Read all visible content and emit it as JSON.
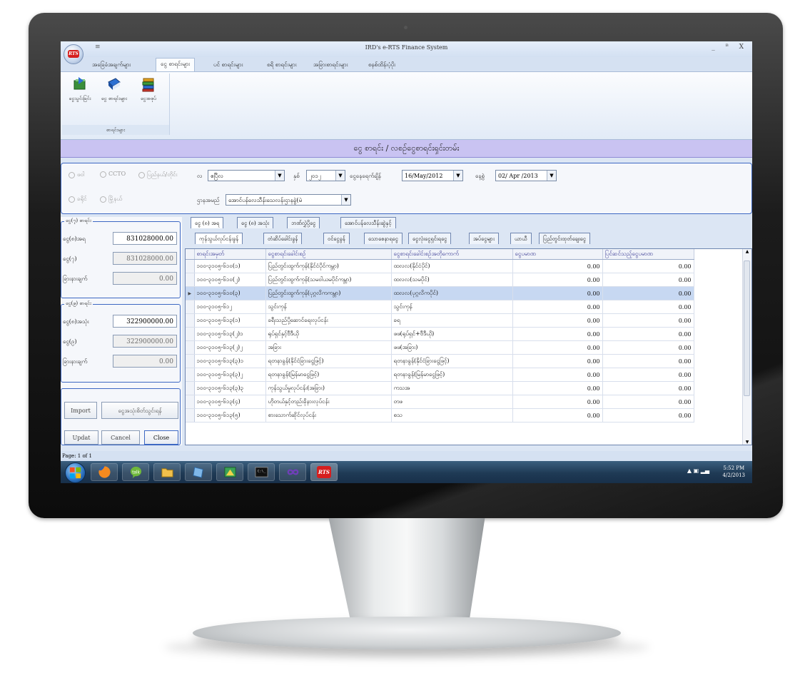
{
  "window": {
    "title": "IRD's e-RTS Finance System",
    "quick_access": "≡",
    "controls": "_ ᴮ X"
  },
  "menu_tabs": [
    {
      "label": "အခြေခံအချက်များ"
    },
    {
      "label": "ငွေ စာရင်းများ"
    },
    {
      "label": "ပင် စာရင်းများ"
    },
    {
      "label": "စရိ စာရင်းများ"
    },
    {
      "label": "အခြားစာရင်းများ"
    },
    {
      "label": "စနစ်ထိန်းပံ့ပိုး"
    }
  ],
  "ribbon": {
    "buttons": [
      {
        "label": "ငွေသွင်းခြင်း"
      },
      {
        "label": "ငွေ စာရင်းများ"
      },
      {
        "label": "ငွေအစုပ်"
      }
    ],
    "group_label": "စာရင်းများ"
  },
  "page_header": "ငွေ စာရင်း / လစဉ်ငွေစာရင်းရှင်းတမ်း",
  "filters": {
    "radios": [
      "ဖဝါ",
      "CCTO",
      "ပြည်နယ်/တိုင်း",
      "ခရိုင်",
      "မြို့နယ်"
    ],
    "month_label": "လ",
    "month_value": "ဧပြီလ",
    "year_label": "နှစ်",
    "year_value": "၂၀၁၂",
    "from_label": "ငွေနေရေက်ချိန်",
    "from_value": "16/May/2012",
    "to_label": "နေ့စွဲ",
    "to_value": "02/ Apr /2013",
    "office_label": "ဌာနအမည်",
    "office_value": "အောင်ပန်လေသီန်းသေလန်းဌာနခွဲ(မဲ"
  },
  "left_panel": {
    "box1": {
      "legend": "ငွေ(၇) စာရင်း",
      "rows": [
        {
          "label": "ငွေ(၈)အရ",
          "value": "831028000.00"
        },
        {
          "label": "ငွေ(၇)",
          "value": "831028000.00"
        },
        {
          "label": "ခြားနားချက်",
          "value": "0.00"
        }
      ]
    },
    "box2": {
      "legend": "ငွေ(၉) စာရင်း",
      "rows": [
        {
          "label": "ငွေ(၈)အသုံး",
          "value": "322900000.00"
        },
        {
          "label": "ငွေ(၉)",
          "value": "322900000.00"
        },
        {
          "label": "ခြားနားချက်",
          "value": "0.00"
        }
      ]
    },
    "import_label": "Import",
    "verify_label": "ငွေအသုံးစိတ်သွင်းရန်",
    "update_label": "Updat",
    "cancel_label": "Cancel",
    "close_label": "Close"
  },
  "tabs_row1": [
    {
      "label": "ငွေ (၈) အရ"
    },
    {
      "label": "ငွေ (၈) အသုံး"
    },
    {
      "label": "ဘဏ်လွှဲပို့ငွေ"
    },
    {
      "label": "အောင်ပန်လေသီန်းဆွဲနှင့်"
    }
  ],
  "tabs_row2": [
    {
      "label": "ကုန်သွယ်လုပ်ငန်းခွန်"
    },
    {
      "label": "တံဆိပ်ခေါင်းခွန်"
    },
    {
      "label": "ဝင်ငွေခွန်"
    },
    {
      "label": "သောစေနာရငွေ"
    },
    {
      "label": "ငွေလုံးငွေရှင်းရငွေ"
    },
    {
      "label": "အပ်ငွေများ"
    },
    {
      "label": "ယာယီ"
    },
    {
      "label": "ပြည်တွင်းထုတ်ချေးငွေ"
    }
  ],
  "table": {
    "columns": [
      "စာရင်းအမှတ်",
      "ငွေစာရင်းခေါင်းစဉ်",
      "ငွေစာရင်းခေါင်းစဉ်အတိုကောက်",
      "ငွေပမာဏ",
      "ပြင်ဆင်သည့်ငွေပမာဏ"
    ],
    "rows": [
      [
        "၁၀၀-၃၁၀၅-၆၁၀(၁)",
        "ပြည်တွင်းထွက်ကုန်(နိုင်ငံပိုင်ကမ္ဘာ)",
        "ထလလ(နိုင်ငံပိုင်)",
        "0.00",
        "0.00"
      ],
      [
        "၁၀၀-၃၁၀၅-၆၁၀(၂)",
        "ပြည်တွင်းထွက်ကုန်(သမဝါယမပိုင်ကမ္ဘာ)",
        "ထလလ(သမပိုင်)",
        "0.00",
        "0.00"
      ],
      [
        "၁၀၀-၃၁၀၅-၆၁၀(၃)",
        "ပြည်တွင်းထွက်ကုန်(ပုဂ္ဂလိကကမ္ဘာ)",
        "ထလလ(ပုဂ္ဂလိကပိုင်)",
        "0.00",
        "0.00"
      ],
      [
        "၁၀၀-၃၁၀၅-၆၁၂",
        "သွင်းကုန်",
        "သွင်းကုန်",
        "0.00",
        "0.00"
      ],
      [
        "၁၀၀-၃၁၀၅-၆၁၃(၁)",
        "ခရီးသည်ပို့ဆောင်ရေးလုပ်ငန်း",
        "ခရ",
        "0.00",
        "0.00"
      ],
      [
        "၁၀၀-၃၁၀၅-၆၁၃(၂)၁",
        "ရုပ်ရှင်နှင့်ဗီဒီယို",
        "ဖဖ(ရုပ်ရှင်+ဗီဒီယို)",
        "0.00",
        "0.00"
      ],
      [
        "၁၀၀-၃၁၀၅-၆၁၃(၂)၂",
        "အခြား",
        "ဖဖ(အခြား)",
        "0.00",
        "0.00"
      ],
      [
        "၁၀၀-၃၁၀၅-၆၁၃(၃)၁",
        "ရတနာခွန်(နိုင်ငံခြားငွေဖြင့်)",
        "ရတနာခွန်(နိုင်ငံခြားငွေဖြင့်)",
        "0.00",
        "0.00"
      ],
      [
        "၁၀၀-၃၁၀၅-၆၁၃(၃)၂",
        "ရတနာခွန်(မြန်မာငွေဖြင့်)",
        "ရတနာခွန်(မြန်မာငွေဖြင့်)",
        "0.00",
        "0.00"
      ],
      [
        "၁၀၀-၃၁၀၅-၆၁၃(၃)၃",
        "ကုန်သွယ်မှုလုပ်ငန်း(အခြား)",
        "ကသအ",
        "0.00",
        "0.00"
      ],
      [
        "၁၀၀-၃၁၀၅-၆၁၃(၄)",
        "ဟိုတယ်နှင့်တည်းခိုနားလုပ်ငန်း",
        "တဖ",
        "0.00",
        "0.00"
      ],
      [
        "၁၀၀-၃၁၀၅-၆၁၃(၅)",
        "စားသောက်ဆိုင်လုပ်ငန်း",
        "စသ",
        "0.00",
        "0.00"
      ]
    ],
    "selected_row": 2
  },
  "statusbar": {
    "page": "Page: 1 of 1"
  },
  "taskbar": {
    "time": "5:52 PM",
    "date": "4/2/2013",
    "rts_label": "RTS"
  }
}
